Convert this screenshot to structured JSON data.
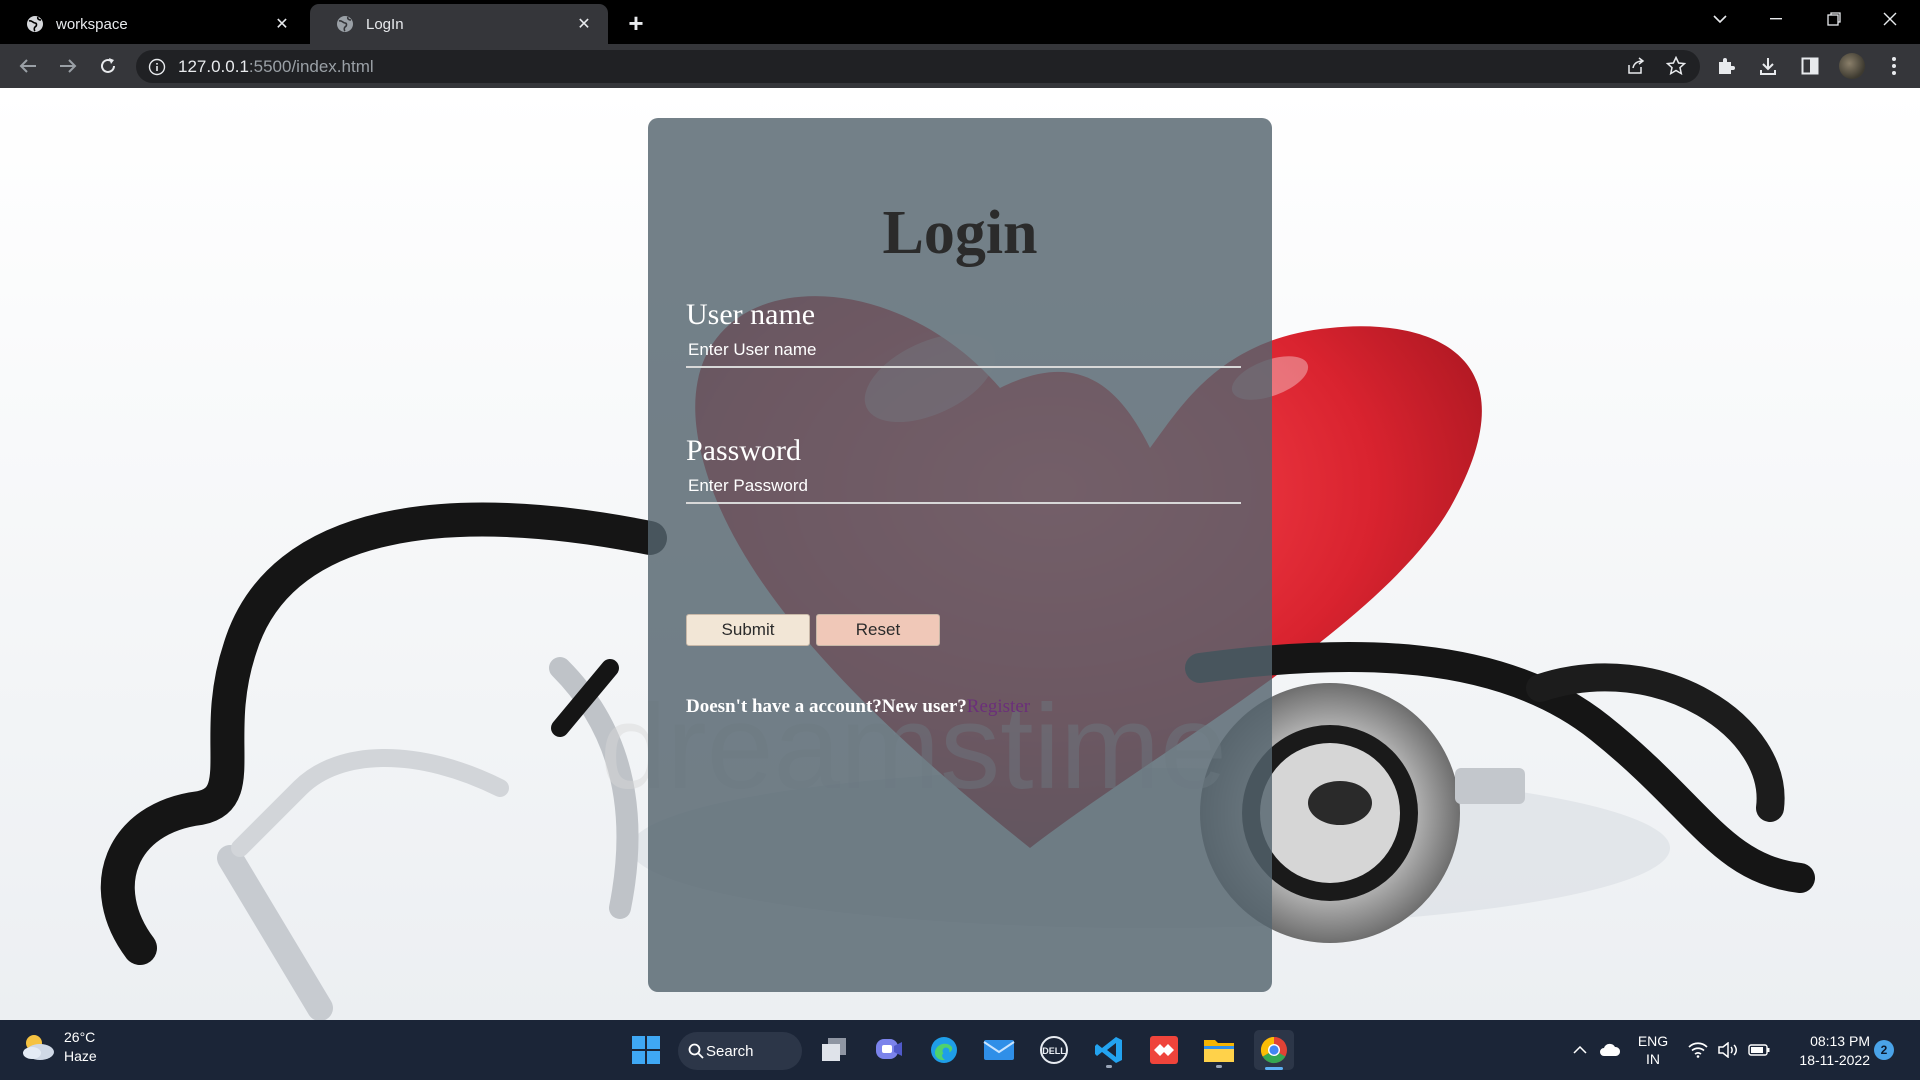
{
  "browser": {
    "tabs": [
      {
        "title": "workspace",
        "active": false
      },
      {
        "title": "LogIn",
        "active": true
      }
    ],
    "url_host": "127.0.0.1",
    "url_rest": ":5500/index.html"
  },
  "login": {
    "title": "Login",
    "username_label": "User name",
    "username_placeholder": "Enter User name",
    "password_label": "Password",
    "password_placeholder": "Enter Password",
    "submit_label": "Submit",
    "reset_label": "Reset",
    "register_prompt": "Doesn't have a account?New user?",
    "register_link": "Register"
  },
  "background": {
    "watermark": "dreamstime"
  },
  "taskbar": {
    "temperature": "26°C",
    "weather": "Haze",
    "search_label": "Search",
    "lang_line1": "ENG",
    "lang_line2": "IN",
    "time": "08:13 PM",
    "date": "18-11-2022",
    "notification_count": "2"
  },
  "colors": {
    "card_bg": "#54646e",
    "heart_red": "#d9232f",
    "register_link": "#6b2f7a",
    "taskbar_bg": "#1b2537"
  }
}
